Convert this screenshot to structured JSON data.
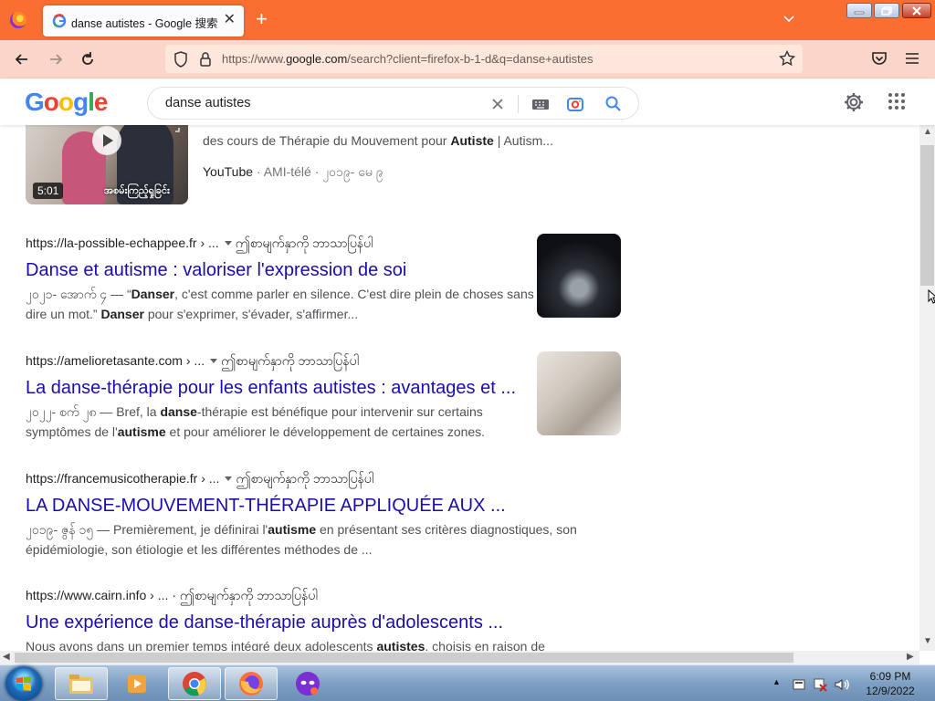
{
  "browser": {
    "tab_title": "danse autistes - Google 搜索",
    "new_tab": "+",
    "url_prefix": "https://www.",
    "url_host": "google.com",
    "url_rest": "/search?client=firefox-b-1-d&q=danse+autistes"
  },
  "google": {
    "logo_letters": [
      "G",
      "o",
      "o",
      "g",
      "l",
      "e"
    ],
    "logo_colors": [
      "#4285f4",
      "#ea4335",
      "#fbbc05",
      "#4285f4",
      "#34a853",
      "#ea4335"
    ],
    "search_query": "danse autistes"
  },
  "video": {
    "duration": "5:01",
    "caption": "အစမ်းကြည့်ရှုခြင်း",
    "snippet_pre": "des cours de Thérapie du Mouvement pour ",
    "snippet_bold": "Autiste",
    "snippet_post": " | Autism...",
    "source": "YouTube",
    "channel": "AMI-télé",
    "date": "၂၀၁၉- မေ ၉"
  },
  "results": [
    {
      "domain": "https://la-possible-echappee.fr",
      "path": " › ...",
      "translate": "ဤစာမျက်နှာကို ဘာသာပြန်ပါ",
      "title": "Danse et autisme : valoriser l'expression de soi",
      "date": "၂၀၂၁- အောက် ၄",
      "s1_b": "Danser",
      "s1": ", c'est comme parler en silence. C'est dire plein de choses sans dire un mot.” ",
      "s2_b": "Danser",
      "s2": " pour s'exprimer, s'évader, s'affirmer..."
    },
    {
      "domain": "https://amelioretasante.com",
      "path": " › ...",
      "translate": "ဤစာမျက်နှာကို ဘာသာပြန်ပါ",
      "title": "La danse-thérapie pour les enfants autistes : avantages et ...",
      "date": "၂၀၂၂- စက် ၂၈",
      "s1_pre": "Bref, la ",
      "s1_b": "danse",
      "s1": "-thérapie est bénéfique pour intervenir sur certains symptômes de l'",
      "s2_b": "autisme",
      "s2": " et pour améliorer le développement de certaines zones."
    },
    {
      "domain": "https://francemusicotherapie.fr",
      "path": " › ...",
      "translate": "ဤစာမျက်နှာကို ဘာသာပြန်ပါ",
      "title": "LA DANSE-MOUVEMENT-THÉRAPIE APPLIQUÉE AUX ...",
      "date": "၂၀၁၉- ဇွန် ၁၅",
      "s1_pre": "Premièrement, je définirai l'",
      "s1_b": "autisme",
      "s1": " en présentant ses critères diagnostiques, son épidémiologie, son étiologie et les différentes méthodes de ..."
    },
    {
      "domain": "https://www.cairn.info",
      "path": " › ... · ",
      "translate": "ဤစာမျက်နှာကို ဘာသာပြန်ပါ",
      "title": "Une expérience de danse-thérapie auprès d'adolescents ...",
      "s1_pre": "Nous avons dans un premier temps intégré deux adolescents ",
      "s1_b": "autistes",
      "s1": ", choisis en raison de"
    }
  ],
  "taskbar": {
    "time": "6:09 PM",
    "date": "12/9/2022"
  },
  "colors": {
    "firefox_tabstrip": "#fa6e32",
    "firefox_navbar": "#fbd5c7",
    "link": "#1a0dab"
  }
}
